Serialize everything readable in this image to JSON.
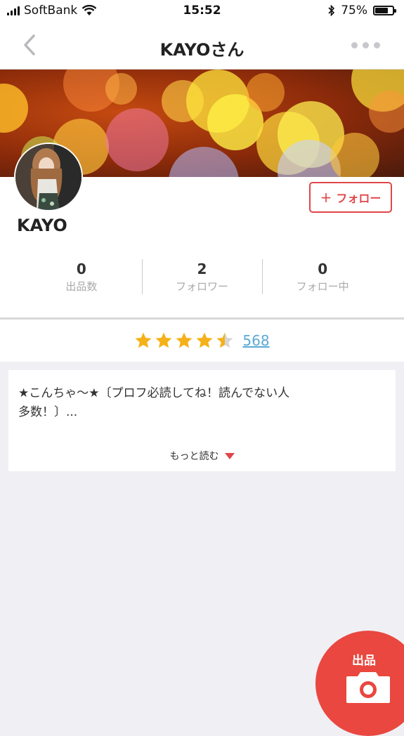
{
  "status_bar": {
    "carrier": "SoftBank",
    "time": "15:52",
    "battery_percent": "75%",
    "battery_level": 0.75,
    "icons": [
      "signal-icon",
      "wifi-icon",
      "bluetooth-icon",
      "battery-icon"
    ]
  },
  "nav": {
    "title": "KAYOさん",
    "back_icon": "chevron-left-icon",
    "more_icon": "more-dots-icon"
  },
  "profile": {
    "username": "KAYO",
    "follow_label": "フォロー",
    "follow_icon": "plus-icon",
    "stats": [
      {
        "value": "0",
        "label": "出品数"
      },
      {
        "value": "2",
        "label": "フォロワー"
      },
      {
        "value": "0",
        "label": "フォロー中"
      }
    ]
  },
  "rating": {
    "stars": 4.5,
    "max_stars": 5,
    "count": "568"
  },
  "description": {
    "text": "★こんちゃ〜★〔プロフ必読してね！読んでない人\n多数！〕...",
    "read_more": "もっと読む"
  },
  "fab": {
    "label": "出品",
    "icon": "camera-icon"
  },
  "colors": {
    "accent": "#e0464a",
    "link": "#5aa9d6",
    "star": "#f5b119",
    "star_empty": "#d6d6d6",
    "fab": "#e9473f"
  }
}
